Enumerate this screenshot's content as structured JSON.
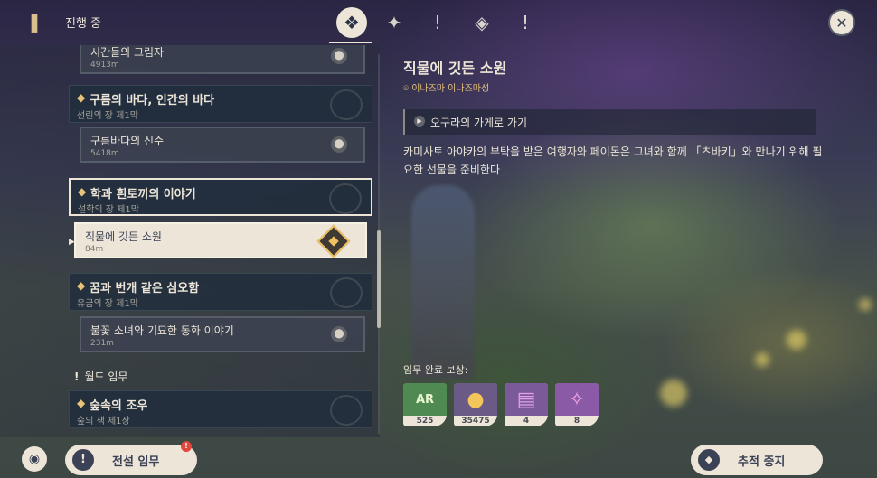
{
  "topbar": {
    "title": "진행 중",
    "tabs": [
      {
        "icon": "archon-quest-icon",
        "glyph": "❖"
      },
      {
        "icon": "story-quest-icon",
        "glyph": "✦"
      },
      {
        "icon": "world-quest-icon",
        "glyph": "!"
      },
      {
        "icon": "event-quest-icon",
        "glyph": "◈"
      },
      {
        "icon": "commission-quest-icon",
        "glyph": "!"
      }
    ],
    "close_glyph": "✕"
  },
  "quest_list": {
    "chapters": [
      {
        "title": "구름의 바다, 인간의 바다",
        "sub": "선린의 장 제1막"
      },
      {
        "title": "학과 흰토끼의 이야기",
        "sub": "설학의 장 제1막"
      },
      {
        "title": "꿈과 번개 같은 심오함",
        "sub": "유금의 장 제1막"
      },
      {
        "title": "숲속의 조우",
        "sub": "숲의 책 제1장"
      }
    ],
    "quests": [
      {
        "title": "시간들의 그림자",
        "dist": "4913m"
      },
      {
        "title": "구름바다의 신수",
        "dist": "5418m"
      },
      {
        "title": "직물에 깃든 소원",
        "dist": "84m"
      },
      {
        "title": "불꽃 소녀와 기묘한 동화 이야기",
        "dist": "231m"
      }
    ],
    "section_world": "월드 임무"
  },
  "detail": {
    "title": "직물에 깃든 소원",
    "location": "이나즈마 이나즈마성",
    "objective": "오구라의 가게로 가기",
    "description": "카미사토 아야카의 부탁을 받은 여행자와 페이몬은 그녀와 함께 「츠바키」와 만나기 위해 필요한 선물을 준비한다",
    "rewards_label": "임무 완료 보상:",
    "rewards": [
      {
        "name": "adventure-exp-icon",
        "count": "525",
        "bg": "#4f8a52",
        "glyph": "AR"
      },
      {
        "name": "mora-icon",
        "count": "35475",
        "bg": "#6b5a86",
        "glyph": "●"
      },
      {
        "name": "heros-wit-icon",
        "count": "4",
        "bg": "#7b5a9a",
        "glyph": "▤"
      },
      {
        "name": "mystic-ore-icon",
        "count": "8",
        "bg": "#8a5aa6",
        "glyph": "✧"
      }
    ]
  },
  "bottom": {
    "legend_label": "전설 임무",
    "legend_badge": "!",
    "stop_label": "추적 중지"
  },
  "colors": {
    "accent_gold": "#e6c27a",
    "panel_dark": "#212d3c",
    "cream": "#ece5d8",
    "badge_red": "#e1473d"
  }
}
